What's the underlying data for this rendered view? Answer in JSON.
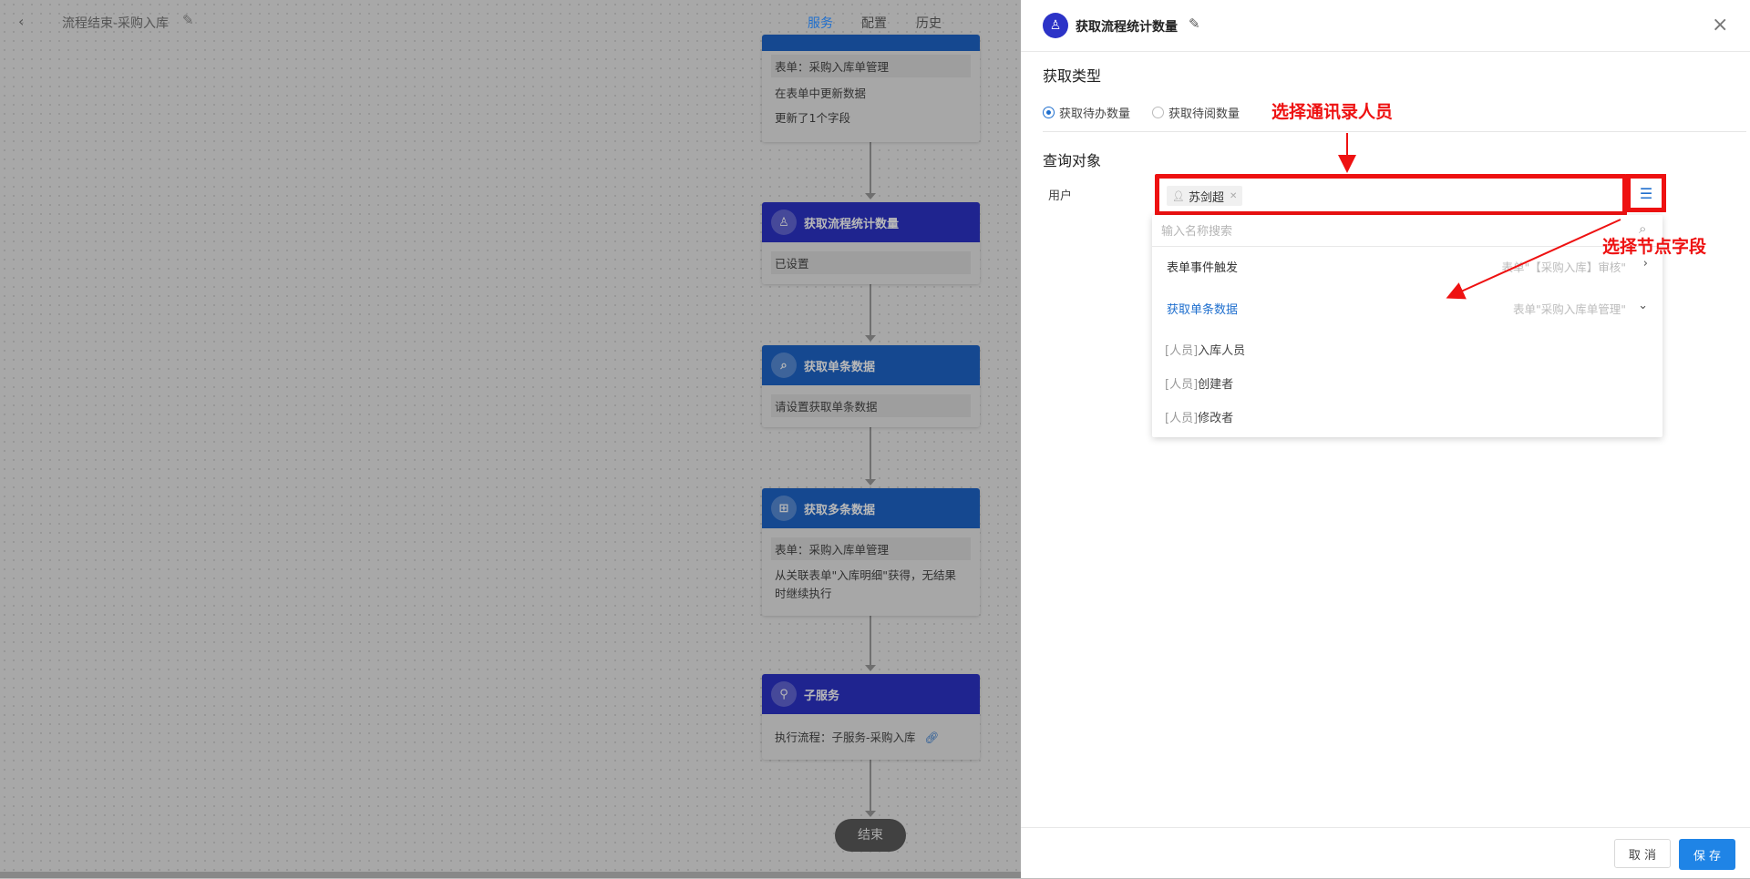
{
  "topbar": {
    "back_icon": "‹",
    "title": "流程结束-采购入库",
    "edit_icon": "✎",
    "tabs": [
      {
        "label": "服务",
        "active": true
      },
      {
        "label": "配置",
        "active": false
      },
      {
        "label": "历史",
        "active": false
      }
    ]
  },
  "flow": {
    "nodes": [
      {
        "lines": [
          "表单：采购入库单管理",
          "在表单中更新数据",
          "更新了1个字段"
        ]
      },
      {
        "title": "获取流程统计数量",
        "icon": "stamp-icon",
        "lines": [
          "已设置"
        ]
      },
      {
        "title": "获取单条数据",
        "icon": "search-icon",
        "lines": [
          "请设置获取单条数据"
        ]
      },
      {
        "title": "获取多条数据",
        "icon": "multi-data-icon",
        "lines": [
          "表单：采购入库单管理",
          "从关联表单\"入库明细\"获得，无结果时继续执行"
        ]
      },
      {
        "title": "子服务",
        "icon": "subservice-icon",
        "lines": [
          "执行流程：子服务-采购入库"
        ]
      }
    ],
    "end_label": "结束"
  },
  "drawer": {
    "title": "获取流程统计数量",
    "header_icon": "stamp-icon",
    "close_icon": "×",
    "section_type": "获取类型",
    "radio_options": [
      {
        "label": "获取待办数量",
        "checked": true
      },
      {
        "label": "获取待阅数量",
        "checked": false
      }
    ],
    "section_query": "查询对象",
    "user_label": "用户",
    "user_tag": "苏剑超",
    "dropdown": {
      "search_placeholder": "输入名称搜索",
      "groups": [
        {
          "label": "表单事件触发",
          "meta": "表单\"【采购入库】审核\"",
          "expanded": false
        },
        {
          "label": "获取单条数据",
          "meta": "表单\"采购入库单管理\"",
          "expanded": true
        }
      ],
      "items": [
        {
          "tag": "[人员]",
          "name": "入库人员"
        },
        {
          "tag": "[人员]",
          "name": "创建者"
        },
        {
          "tag": "[人员]",
          "name": "修改者"
        }
      ]
    },
    "annotations": {
      "select_contact": "选择通讯录人员",
      "select_node_field": "选择节点字段"
    },
    "footer": {
      "cancel": "取 消",
      "save": "保 存"
    }
  },
  "colors": {
    "accent": "#1f6fce",
    "annotation": "#ee1111",
    "node_navy": "#2c33c7",
    "node_blue": "#1e64c8"
  }
}
